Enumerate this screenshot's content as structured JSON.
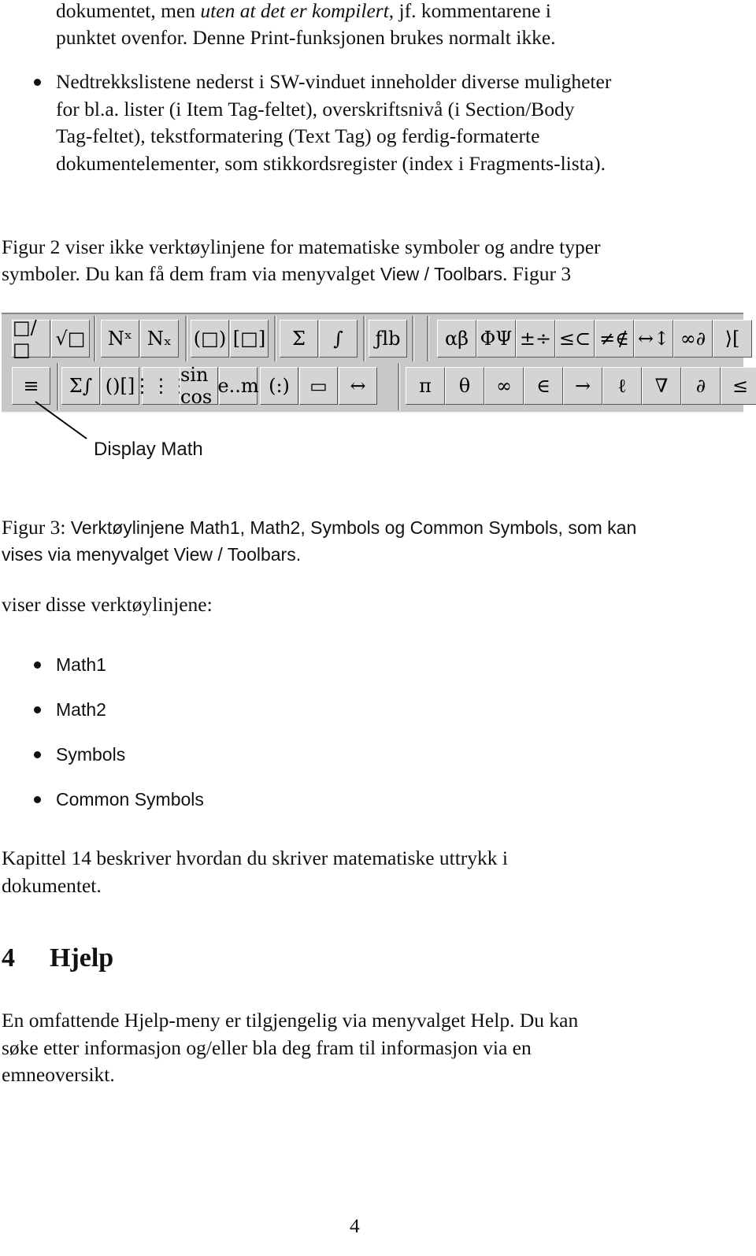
{
  "para_top": {
    "lines": [
      [
        {
          "t": "dokumentet, men "
        },
        {
          "t": "uten at det er kompilert",
          "s": "it"
        },
        {
          "t": ", jf. kommentarene i"
        }
      ],
      [
        {
          "t": "punktet ovenfor. Denne Print-funksjonen brukes normalt ikke."
        }
      ]
    ]
  },
  "bullet_top": {
    "lines": [
      "Nedtrekkslistene nederst i SW-vinduet inneholder diverse muligheter",
      "for bl.a. lister (i Item Tag-feltet), overskriftsnivå (i Section/Body",
      "Tag-feltet), tekstformatering (Text Tag) og ferdig-formaterte",
      "dokumentelementer, som stikkordsregister (index i Fragments-lista)."
    ]
  },
  "para_fig2": {
    "line1": "Figur 2 viser ikke verktøylinjene for matematiske symboler og andre typer",
    "line2_a": "symboler. Du kan få dem fram via menyvalget ",
    "line2_b": "View / Toolbars",
    "line2_c": ". Figur 3"
  },
  "toolbar": {
    "row1_math": [
      "□/□",
      "√□",
      "Nˣ",
      "Nₓ",
      "(□)",
      "[□]",
      "Σ",
      "∫",
      "ƒlb"
    ],
    "row1_symbols": [
      "αβ",
      "ΦΨ",
      "±÷",
      "≤⊂",
      "≠∉",
      "↔↕",
      "∞∂",
      "⟩["
    ],
    "row2_math": [
      "≡",
      "Σ∫",
      "()[]",
      "⋮⋮⋮",
      "sin cos",
      "e..m",
      "(:)",
      "▭",
      "↔"
    ],
    "row2_common": [
      "π",
      "θ",
      "∞",
      "∈",
      "→",
      "ℓ",
      "∇",
      "∂",
      "≤"
    ]
  },
  "callout": "Display Math",
  "caption": {
    "prefix": "Figur 3: ",
    "line1": "Verktøylinjene Math1, Math2, Symbols og Common Symbols, som kan",
    "line2": "vises via menyvalget View / Toolbars."
  },
  "para_list_intro": "viser disse verktøylinjene:",
  "toolbar_list": [
    "Math1",
    "Math2",
    "Symbols",
    "Common Symbols"
  ],
  "para_chapter": {
    "lines": [
      "Kapittel 14 beskriver hvordan du skriver matematiske uttrykk i",
      "dokumentet."
    ]
  },
  "section": {
    "number": "4",
    "title": "Hjelp"
  },
  "para_help": {
    "lines": [
      "En omfattende Hjelp-meny er tilgjengelig via menyvalget Help. Du kan",
      "søke etter informasjon og/eller bla deg fram til informasjon via en",
      "emneoversikt."
    ]
  },
  "page_number": "4"
}
